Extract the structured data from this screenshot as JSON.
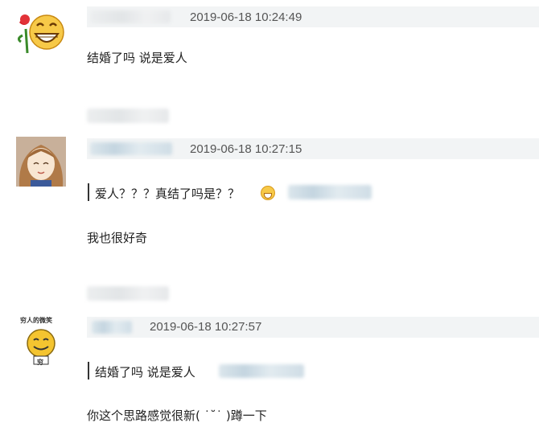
{
  "comments": [
    {
      "avatar": "rose-grinning-emoji-avatar",
      "timestamp": "2019-06-18 10:24:49",
      "text": "结婚了吗 说是爱人"
    },
    {
      "avatar": "anime-girl-avatar",
      "timestamp": "2019-06-18 10:27:15",
      "quote": "爱人？？？真结了吗是？？",
      "quote_icon": "laughing-emoji-icon",
      "text": "我也很好奇"
    },
    {
      "avatar": "smiling-face-meme-avatar",
      "avatar_caption": "穷人的微笑",
      "avatar_badge": "穷",
      "timestamp": "2019-06-18 10:27:57",
      "quote": "结婚了吗 说是爱人",
      "text": "你这个思路感觉很新( ˙˘˙ )蹲一下"
    }
  ],
  "colors": {
    "header_bg": "#f2f4f5",
    "timestamp": "#555555",
    "text": "#222222"
  }
}
